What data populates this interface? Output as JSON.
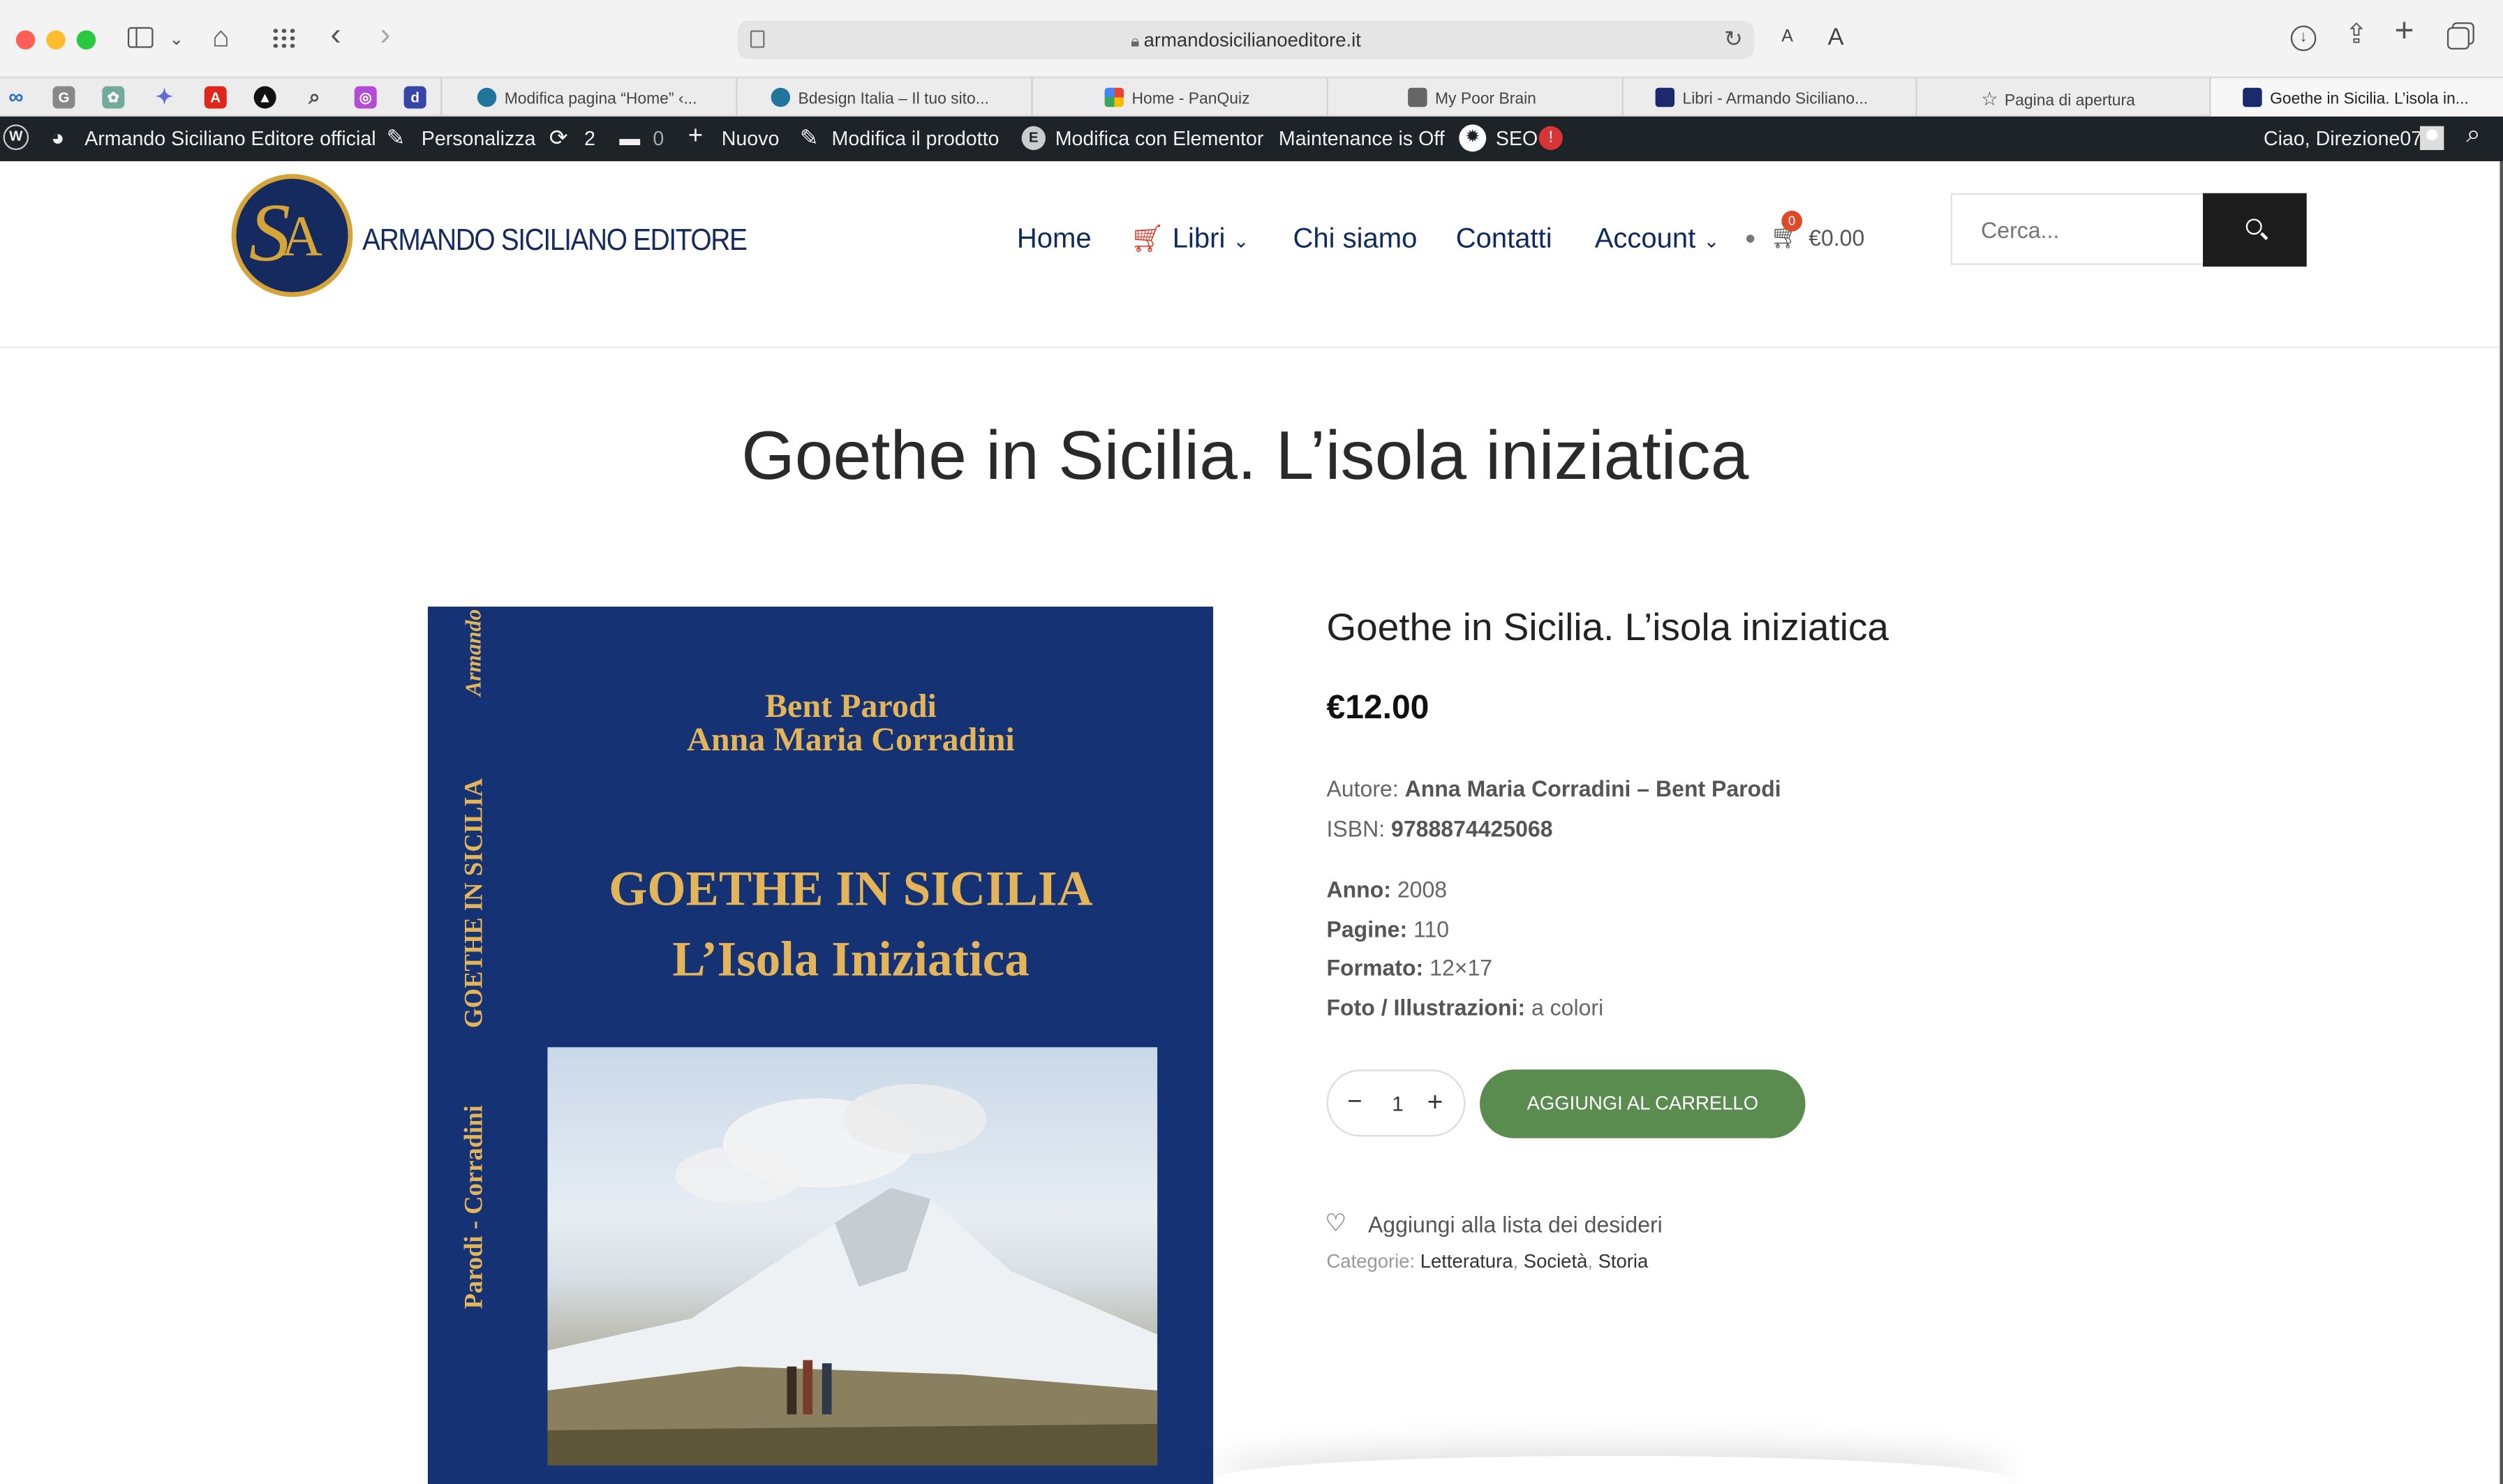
{
  "browser": {
    "url": "armandosicilianoeditore.it",
    "text_small": "A",
    "text_large": "A",
    "tabs": [
      {
        "label": "Modifica pagina “Home” ‹..."
      },
      {
        "label": "Bdesign Italia – Il tuo sito..."
      },
      {
        "label": "Home - PanQuiz"
      },
      {
        "label": "My Poor Brain"
      },
      {
        "label": "Libri - Armando Siciliano..."
      },
      {
        "label": "Pagina di apertura"
      },
      {
        "label": "Goethe in Sicilia. L’isola in..."
      }
    ],
    "favorites": [
      "meta-icon",
      "g-icon",
      "chatgpt-icon",
      "gemini-icon",
      "acrobat-icon",
      "triangle-icon",
      "search-icon",
      "copilot-icon",
      "d-icon"
    ]
  },
  "admin_bar": {
    "site_name": "Armando Siciliano Editore official",
    "customize": "Personalizza",
    "updates": "2",
    "comments": "0",
    "new": "Nuovo",
    "edit_product": "Modifica il prodotto",
    "elementor": "Modifica con Elementor",
    "maintenance": "Maintenance is Off",
    "seo": "SEO",
    "seo_badge": "!",
    "greeting": "Ciao, Direzione07"
  },
  "site": {
    "logo_text": "ARMANDO SICILIANO EDITORE",
    "nav": [
      "Home",
      "Libri",
      "Chi siamo",
      "Contatti",
      "Account"
    ],
    "cart_count": "0",
    "cart_total": "€0.00",
    "search_placeholder": "Cerca..."
  },
  "product": {
    "page_title": "Goethe in Sicilia. L’isola iniziatica",
    "title": "Goethe in Sicilia. L’isola iniziatica",
    "price": "€12.00",
    "author_label": "Autore:",
    "author": "Anna Maria Corradini – Bent Parodi",
    "isbn_label": "ISBN:",
    "isbn": "9788874425068",
    "year_label": "Anno:",
    "year": "2008",
    "pages_label": "Pagine:",
    "pages": "110",
    "format_label": "Formato:",
    "format": "12×17",
    "illustrations_label": "Foto / Illustrazioni:",
    "illustrations": "a colori",
    "quantity": "1",
    "add_to_cart": "AGGIUNGI AL CARRELLO",
    "wishlist": "Aggiungi alla lista dei desideri",
    "categories_label": "Categorie:",
    "categories": [
      "Letteratura",
      "Società",
      "Storia"
    ]
  },
  "cover": {
    "authors_line1": "Bent Parodi",
    "authors_line2": "Anna Maria Corradini",
    "title_line1": "GOETHE IN SICILIA",
    "title_line2": "L’Isola Iniziatica",
    "spine_publisher": "Armando Siciliano Editore",
    "spine_title": "GOETHE IN SICILIA",
    "spine_authors": "Parodi - Corradini"
  }
}
